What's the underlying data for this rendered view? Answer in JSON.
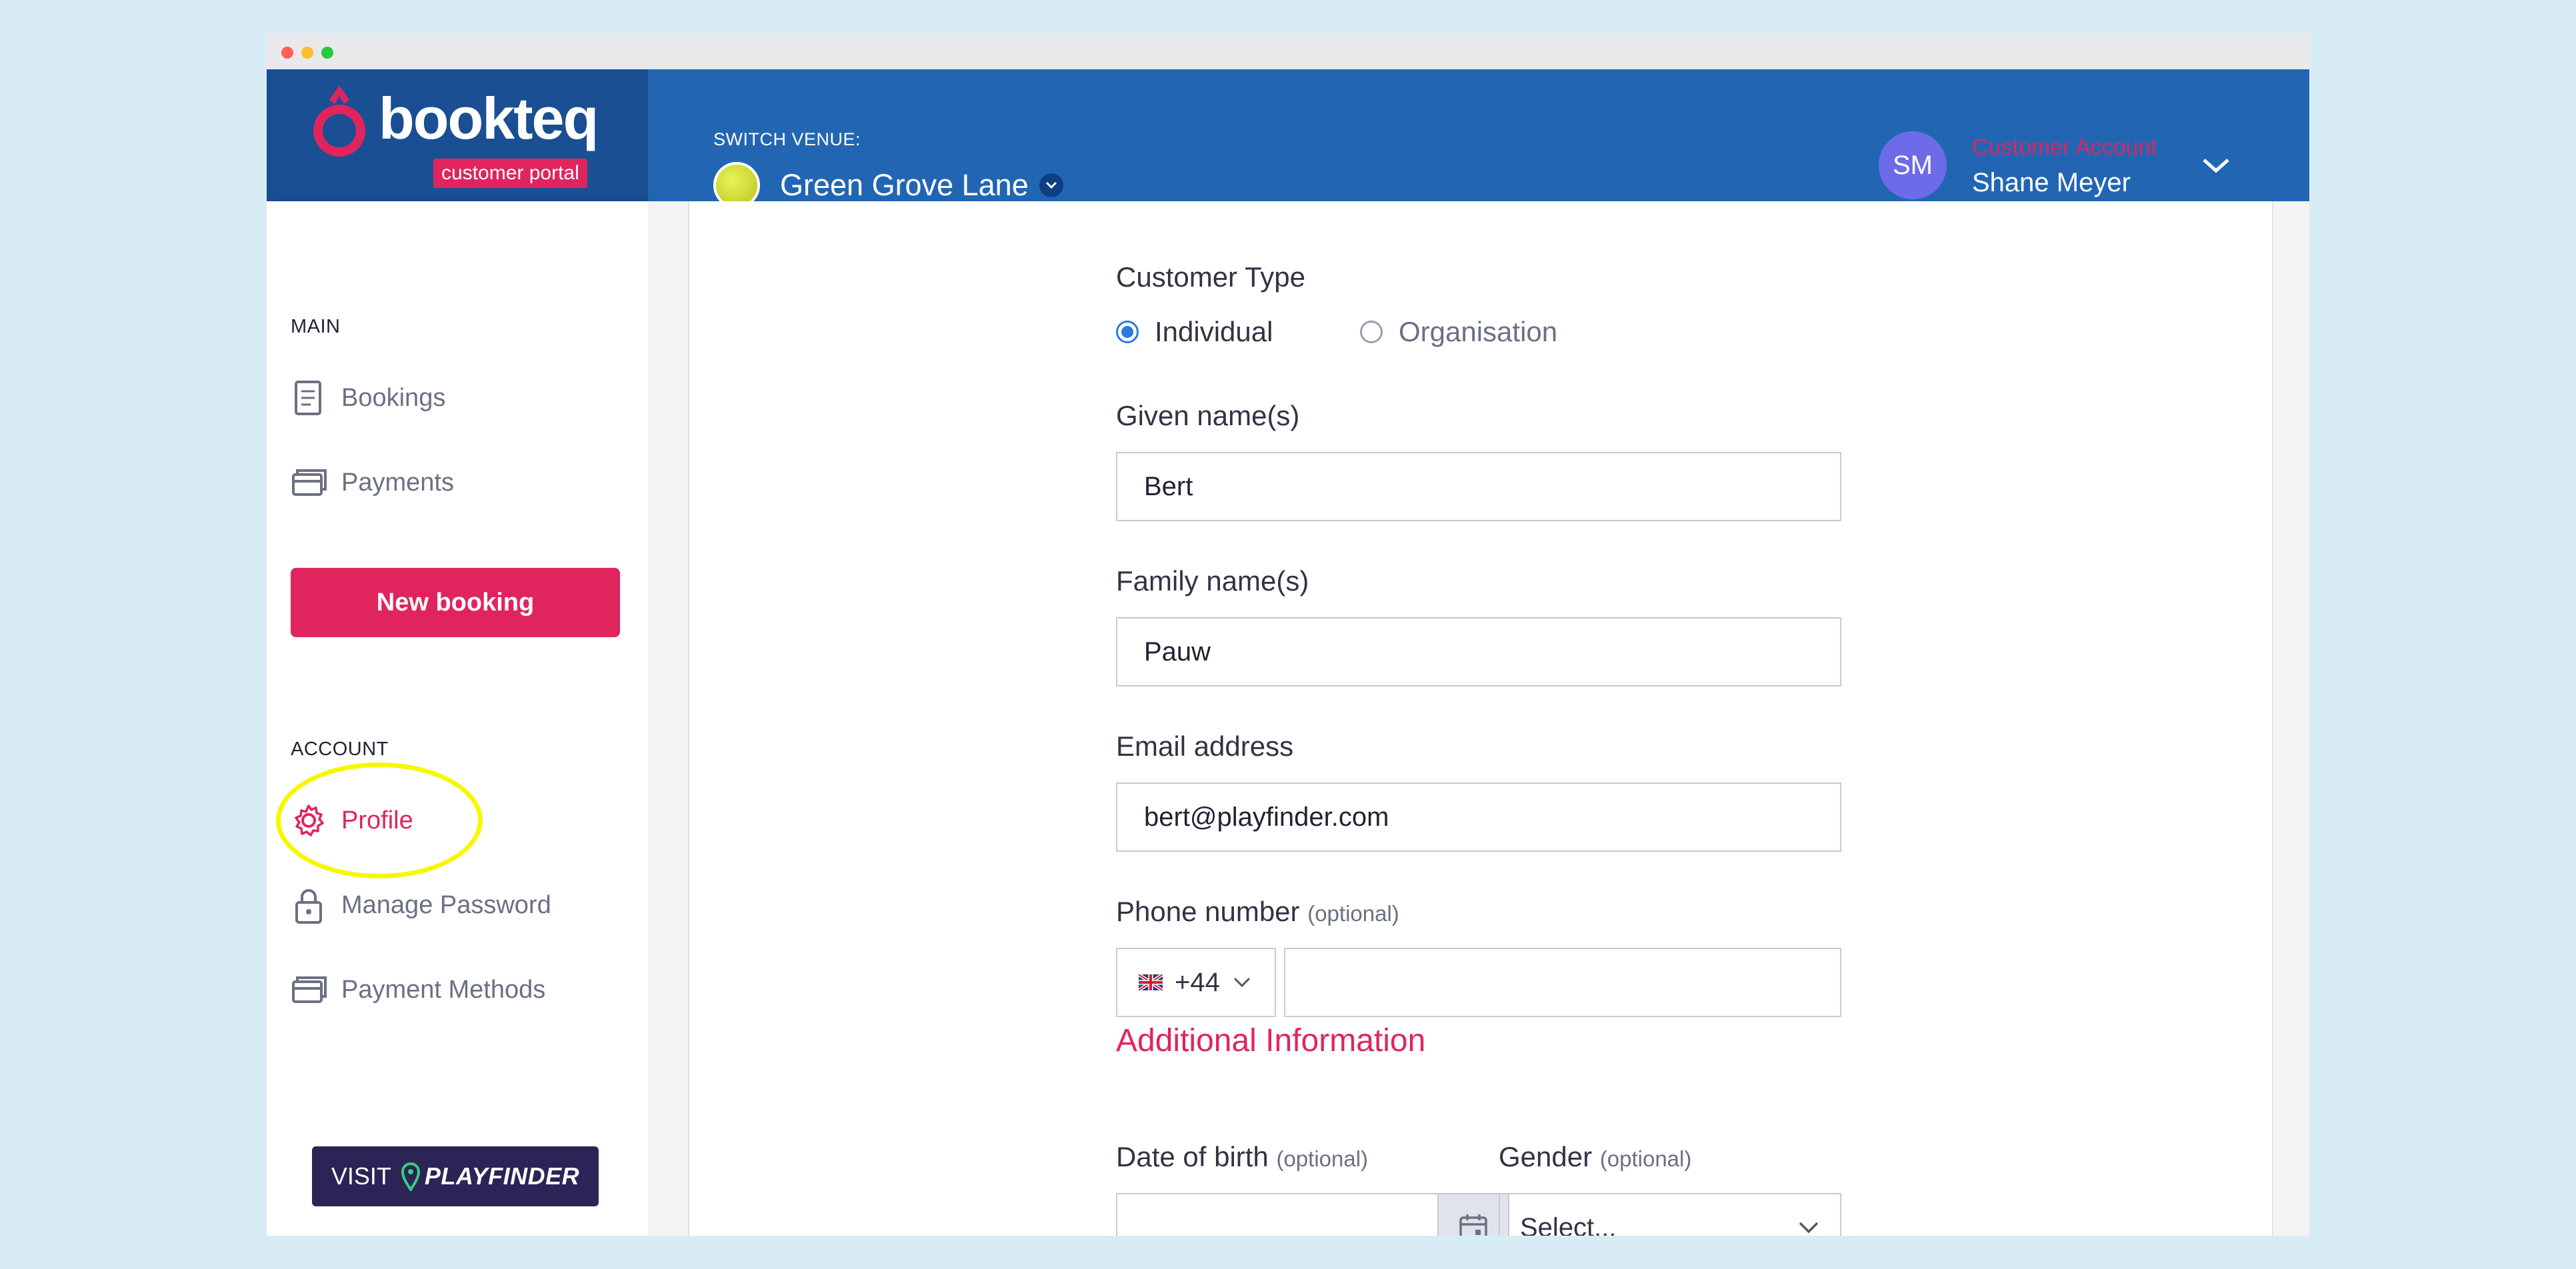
{
  "header": {
    "logo_text": "bookteq",
    "logo_badge": "customer portal",
    "venue_label": "SWITCH VENUE:",
    "venue_name": "Green Grove Lane",
    "avatar_initials": "SM",
    "account_type": "Customer Account",
    "account_name": "Shane Meyer"
  },
  "sidebar": {
    "main_label": "MAIN",
    "main_items": [
      {
        "label": "Bookings",
        "icon": "receipt-icon"
      },
      {
        "label": "Payments",
        "icon": "cards-icon"
      }
    ],
    "new_booking_label": "New booking",
    "account_label": "ACCOUNT",
    "account_items": [
      {
        "label": "Profile",
        "icon": "gear-icon",
        "active": true
      },
      {
        "label": "Manage Password",
        "icon": "lock-icon"
      },
      {
        "label": "Payment Methods",
        "icon": "cards-icon"
      }
    ],
    "visit_label": "VISIT",
    "visit_brand": "PLAYFINDER"
  },
  "form": {
    "customer_type_label": "Customer Type",
    "customer_type_options": [
      "Individual",
      "Organisation"
    ],
    "customer_type_selected": "Individual",
    "given_name_label": "Given name(s)",
    "given_name_value": "Bert",
    "family_name_label": "Family name(s)",
    "family_name_value": "Pauw",
    "email_label": "Email address",
    "email_value": "bert@playfinder.com",
    "phone_label": "Phone number",
    "optional_label": "(optional)",
    "phone_country_code": "+44",
    "phone_value": "",
    "additional_title": "Additional Information",
    "dob_label": "Date of birth",
    "dob_value": "",
    "gender_label": "Gender",
    "gender_value": "Select..."
  },
  "colors": {
    "brand_blue": "#2266b3",
    "brand_pink": "#e0245e",
    "highlight": "#f7f700"
  }
}
